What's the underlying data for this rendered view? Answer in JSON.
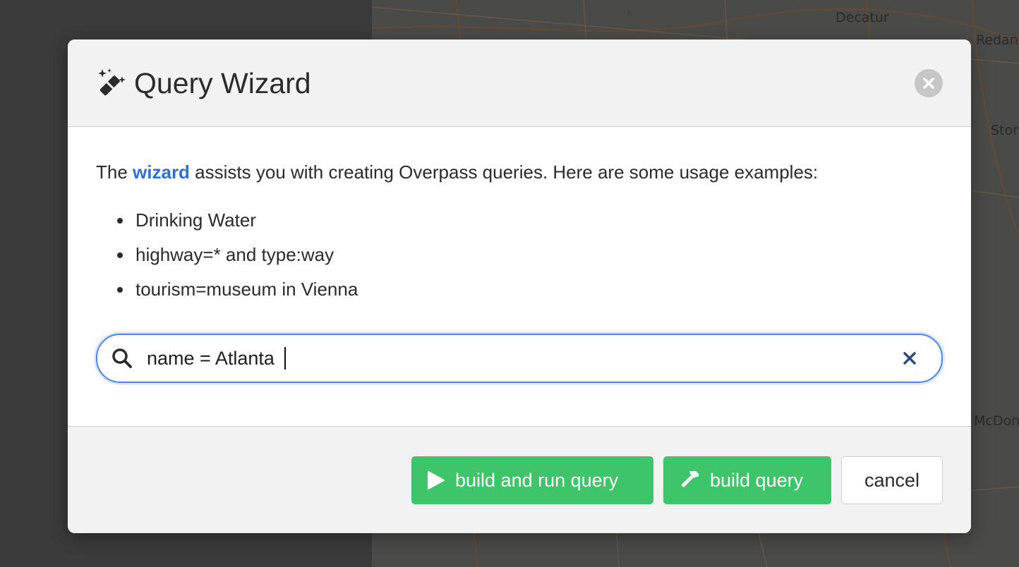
{
  "map": {
    "labels": {
      "decatur": "Decatur",
      "redan": "Redan",
      "stone": "Stor",
      "mcdonough": "McDon"
    }
  },
  "modal": {
    "title": "Query Wizard",
    "title_icon": "magic-wand-icon",
    "close_icon": "close-icon"
  },
  "body": {
    "intro_before": "The ",
    "intro_link": "wizard",
    "intro_after": " assists you with creating Overpass queries. Here are some usage examples:",
    "examples": [
      "Drinking Water",
      "highway=* and type:way",
      "tourism=museum in Vienna"
    ]
  },
  "search": {
    "value": "name = Atlanta",
    "icon": "search-icon",
    "clear_icon": "clear-icon"
  },
  "footer": {
    "build_and_run_label": "build and run query",
    "build_label": "build query",
    "cancel_label": "cancel"
  },
  "colors": {
    "accent_green": "#3ec56a",
    "link_blue": "#2f6fd6",
    "focus_blue": "#4a86e8"
  }
}
